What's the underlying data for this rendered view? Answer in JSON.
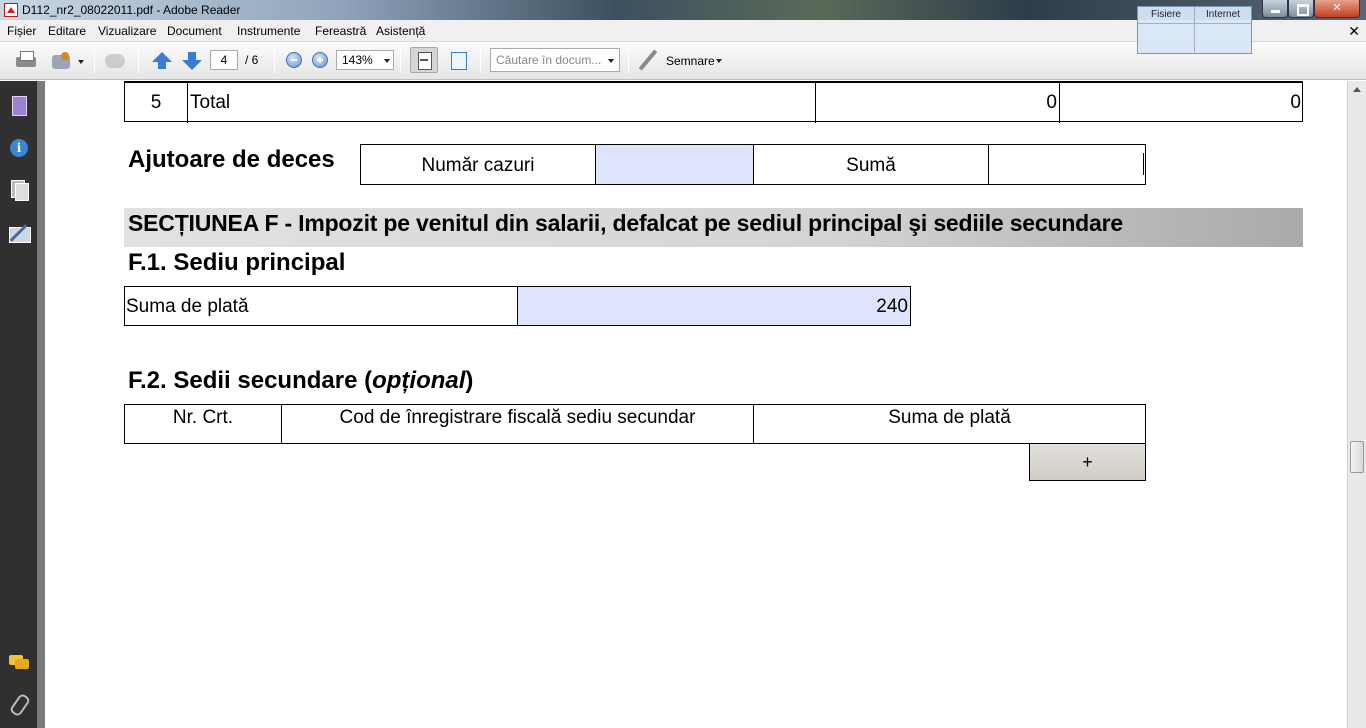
{
  "window": {
    "title": "D112_nr2_08022011.pdf - Adobe Reader",
    "overlay_tabs": [
      "Fisiere",
      "Internet"
    ],
    "minimize": "",
    "maximize": "",
    "close": "✕"
  },
  "menu": {
    "items": [
      "Fișier",
      "Editare",
      "Vizualizare",
      "Document",
      "Instrumente",
      "Fereastră",
      "Asistență"
    ],
    "close_doc": "✕"
  },
  "toolbar": {
    "page_current": "4",
    "page_total": "/ 6",
    "zoom": "143%",
    "search_placeholder": "Căutare în docum...",
    "sign_label": "Semnare"
  },
  "document": {
    "total_row": {
      "nr": "5",
      "label": "Total",
      "value1": "0",
      "value2": "0"
    },
    "ajutoare": {
      "heading": "Ajutoare de deces",
      "numar_label": "Număr cazuri",
      "numar_value": "",
      "suma_label": "Sumă",
      "suma_value": ""
    },
    "section_f": {
      "title": "SECȚIUNEA F - Impozit pe venitul din salarii, defalcat pe sediul principal şi sediile secundare",
      "f1_heading": "F.1. Sediu principal",
      "suma_label": "Suma de plată",
      "suma_value": "240",
      "f2_heading_prefix": "F.2. Sedii secundare (",
      "f2_heading_italic": "opțional",
      "f2_heading_suffix": ")",
      "table_headers": [
        "Nr. Crt.",
        "Cod de înregistrare fiscală sediu secundar",
        "Suma de plată"
      ],
      "add_button": "+"
    }
  }
}
